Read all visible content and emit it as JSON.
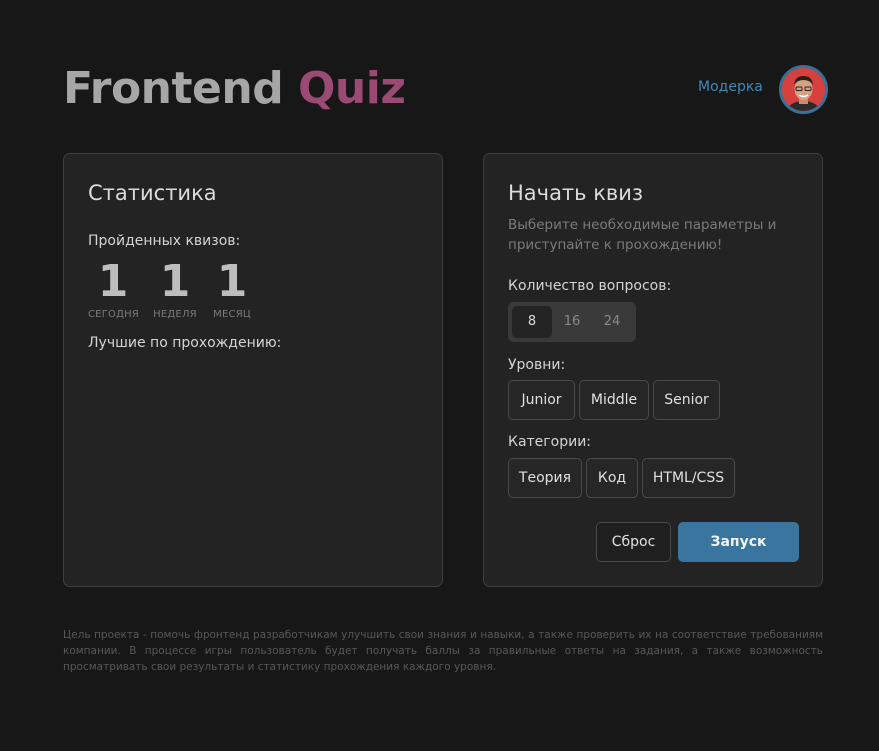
{
  "header": {
    "logo_part1": "Frontend",
    "logo_part2": "Quiz",
    "user_name": "Модерка"
  },
  "stats_card": {
    "title": "Статистика",
    "completed_label": "Пройденных квизов:",
    "stats": [
      {
        "value": "1",
        "caption": "СЕГОДНЯ"
      },
      {
        "value": "1",
        "caption": "НЕДЕЛЯ"
      },
      {
        "value": "1",
        "caption": "МЕСЯЦ"
      }
    ],
    "best_label": "Лучшие по прохождению:"
  },
  "quiz_card": {
    "title": "Начать квиз",
    "subtitle": "Выберите необходимые параметры и приступайте к прохождению!",
    "questions_label": "Количество вопросов:",
    "question_counts": [
      "8",
      "16",
      "24"
    ],
    "selected_count": "8",
    "levels_label": "Уровни:",
    "levels": [
      "Junior",
      "Middle",
      "Senior"
    ],
    "categories_label": "Категории:",
    "categories": [
      "Теория",
      "Код",
      "HTML/CSS"
    ],
    "reset_label": "Сброс",
    "start_label": "Запуск"
  },
  "footer": {
    "text": "Цель проекта - помочь фронтенд разработчикам улучшить свои знания и навыки, а также проверить их на соответствие требованиям компании. В процессе игры пользователь будет получать баллы за правильные ответы на задания, а также возможность просматривать свои результаты и статистику прохождения каждого уровня."
  },
  "colors": {
    "background": "#171717",
    "card": "#232323",
    "accent_blue": "#3a75a0",
    "logo_accent": "#9b4a74"
  }
}
